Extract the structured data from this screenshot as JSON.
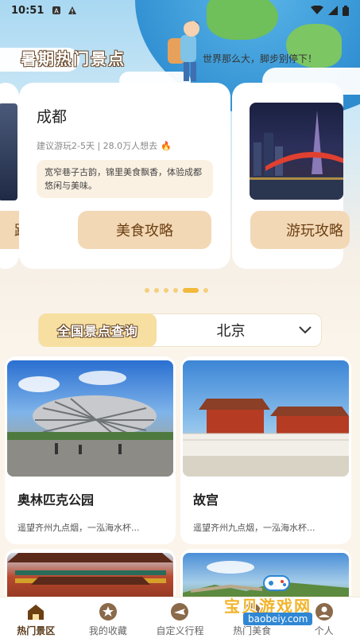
{
  "status_bar": {
    "time": "10:51"
  },
  "hero": {
    "title": "暑期热门景点",
    "slogan": "世界那么大，脚步别停下！"
  },
  "carousel": {
    "cards": [
      {
        "edge_button": "路"
      },
      {
        "city": "成都",
        "meta": "建议游玩2-5天 | 28.0万人想去",
        "fire_icon": "fire-icon",
        "desc": "宽窄巷子古韵，锦里美食飘香，体验成都悠闲与美味。",
        "button": "美食攻略"
      },
      {
        "button": "游玩攻略"
      }
    ],
    "dot_count": 6,
    "active_dot": 4
  },
  "query": {
    "label": "全国景点查询",
    "value": "北京",
    "chevron": "chevron-down-icon"
  },
  "spots": [
    {
      "title": "奥林匹克公园",
      "desc": "遥望齐州九点烟，一泓海水杯..."
    },
    {
      "title": "故宫",
      "desc": "遥望齐州九点烟，一泓海水杯..."
    },
    {
      "title": "",
      "desc": ""
    },
    {
      "title": "",
      "desc": ""
    }
  ],
  "tabbar": {
    "items": [
      {
        "label": "热门景区",
        "icon": "home-icon",
        "active": true
      },
      {
        "label": "我的收藏",
        "icon": "star-icon",
        "active": false
      },
      {
        "label": "自定义行程",
        "icon": "plane-icon",
        "active": false
      },
      {
        "label": "热门美食",
        "icon": "food-icon",
        "active": false
      },
      {
        "label": "个人",
        "icon": "user-icon",
        "active": false
      }
    ]
  },
  "watermark": {
    "text": "宝贝游戏网",
    "url": "baobeiy.com"
  },
  "colors": {
    "accent": "#f2b93b",
    "button_bg": "#f3d8b6",
    "button_text": "#6b3f12",
    "page_bg": "#fbf4ea"
  }
}
